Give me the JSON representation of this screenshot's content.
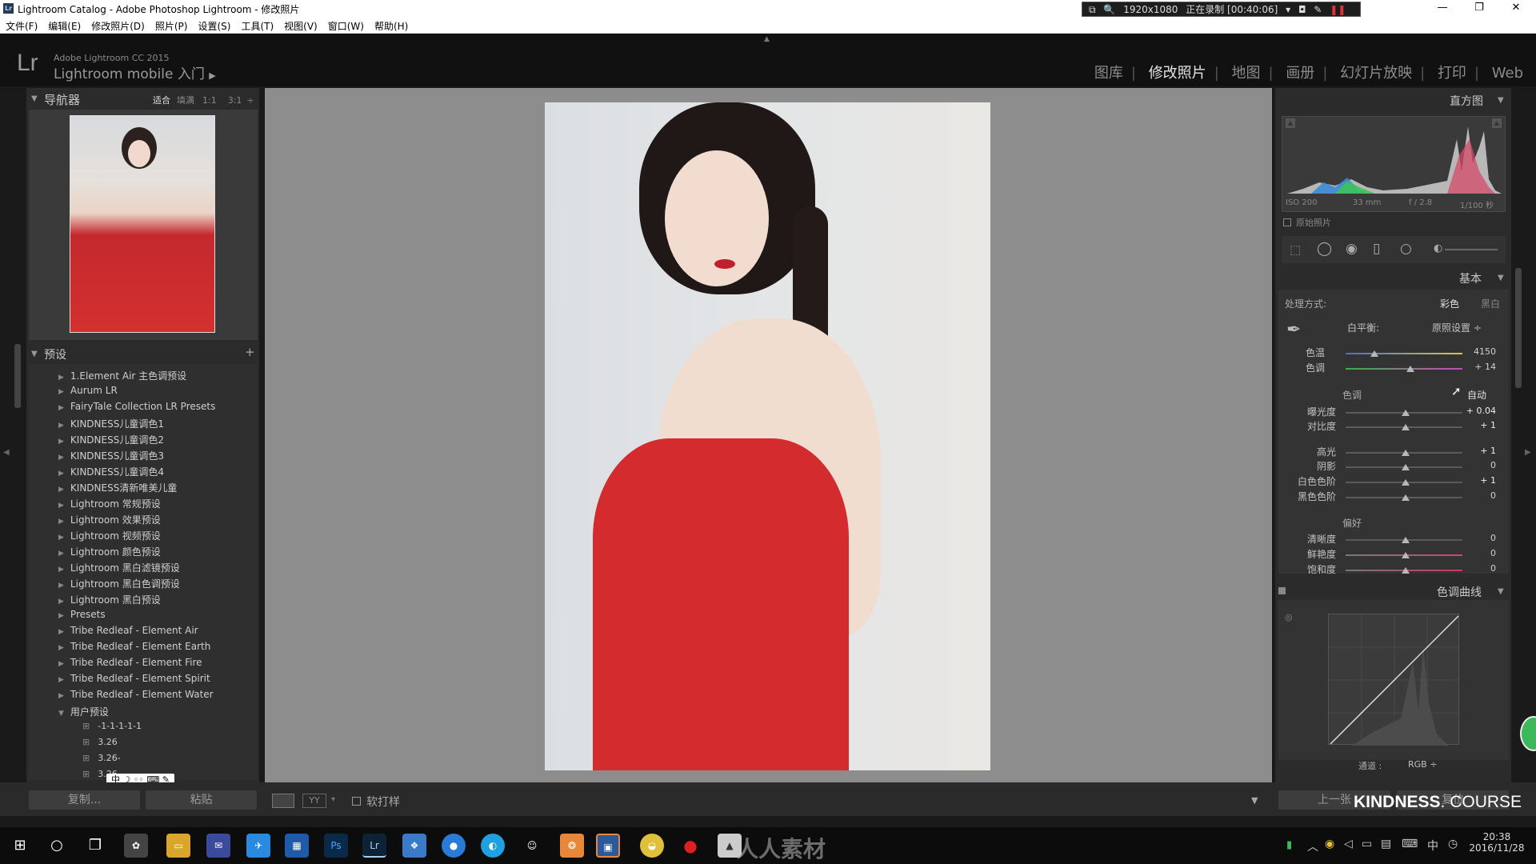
{
  "window": {
    "title": "Lightroom Catalog - Adobe Photoshop Lightroom - 修改照片",
    "recorder": {
      "resolution": "1920x1080",
      "status": "正在录制 [00:40:06]"
    }
  },
  "menu": [
    "文件(F)",
    "编辑(E)",
    "修改照片(D)",
    "照片(P)",
    "设置(S)",
    "工具(T)",
    "视图(V)",
    "窗口(W)",
    "帮助(H)"
  ],
  "identity": {
    "logo": "Lr",
    "version": "Adobe Lightroom CC 2015",
    "mobile": "Lightroom mobile 入门"
  },
  "modules": [
    "图库",
    "修改照片",
    "地图",
    "画册",
    "幻灯片放映",
    "打印",
    "Web"
  ],
  "active_module": "修改照片",
  "navigator": {
    "title": "导航器",
    "zoom": [
      "适合",
      "填满",
      "1:1",
      "3:1"
    ]
  },
  "presets": {
    "title": "预设",
    "items": [
      "1.Element Air 主色调预设",
      "Aurum LR",
      "FairyTale Collection LR Presets",
      "KINDNESS儿童调色1",
      "KINDNESS儿童调色2",
      "KINDNESS儿童调色3",
      "KINDNESS儿童调色4",
      "KINDNESS清新唯美儿童",
      "Lightroom 常规预设",
      "Lightroom 效果预设",
      "Lightroom 视频预设",
      "Lightroom 颜色预设",
      "Lightroom 黑白滤镜预设",
      "Lightroom 黑白色调预设",
      "Lightroom 黑白预设",
      "Presets",
      "Tribe Redleaf - Element Air",
      "Tribe Redleaf - Element Earth",
      "Tribe Redleaf - Element Fire",
      "Tribe Redleaf - Element Spirit",
      "Tribe Redleaf - Element Water",
      "用户预设"
    ],
    "user_items": [
      "-1-1-1-1-1",
      "3.26",
      "3.26-",
      "3.26-"
    ]
  },
  "left_buttons": {
    "copy": "复制...",
    "paste": "粘贴"
  },
  "toolbar": {
    "soft_proof": "软打样"
  },
  "histogram": {
    "title": "直方图",
    "iso": "ISO 200",
    "focal": "33 mm",
    "aperture": "f / 2.8",
    "shutter": "1/100 秒",
    "original": "原始照片"
  },
  "basic": {
    "title": "基本",
    "treatment_label": "处理方式:",
    "color": "彩色",
    "bw": "黑白",
    "wb_label": "白平衡:",
    "wb_value": "原照设置 ÷",
    "temp": {
      "label": "色温",
      "value": "4150"
    },
    "tint": {
      "label": "色调",
      "value": "+ 14"
    },
    "tone_label": "色调",
    "auto": "自动",
    "exposure": {
      "label": "曝光度",
      "value": "+ 0.04"
    },
    "contrast": {
      "label": "对比度",
      "value": "+ 1"
    },
    "highlights": {
      "label": "高光",
      "value": "+ 1"
    },
    "shadows": {
      "label": "阴影",
      "value": "0"
    },
    "whites": {
      "label": "白色色阶",
      "value": "+ 1"
    },
    "blacks": {
      "label": "黑色色阶",
      "value": "0"
    },
    "presence_label": "偏好",
    "clarity": {
      "label": "清晰度",
      "value": "0"
    },
    "vibrance": {
      "label": "鲜艳度",
      "value": "0"
    },
    "saturation": {
      "label": "饱和度",
      "value": "0"
    }
  },
  "tone_curve": {
    "title": "色调曲线",
    "channel_label": "通道 :",
    "channel_value": "RGB ÷"
  },
  "right_buttons": {
    "prev": "上一张",
    "reset": "复位"
  },
  "watermark": {
    "brand": "KINDNESS",
    "course": ". COURSE",
    "site": "人人素材"
  },
  "clock": {
    "time": "20:38",
    "date": "2016/11/28"
  },
  "tray": {
    "ime": "中"
  }
}
